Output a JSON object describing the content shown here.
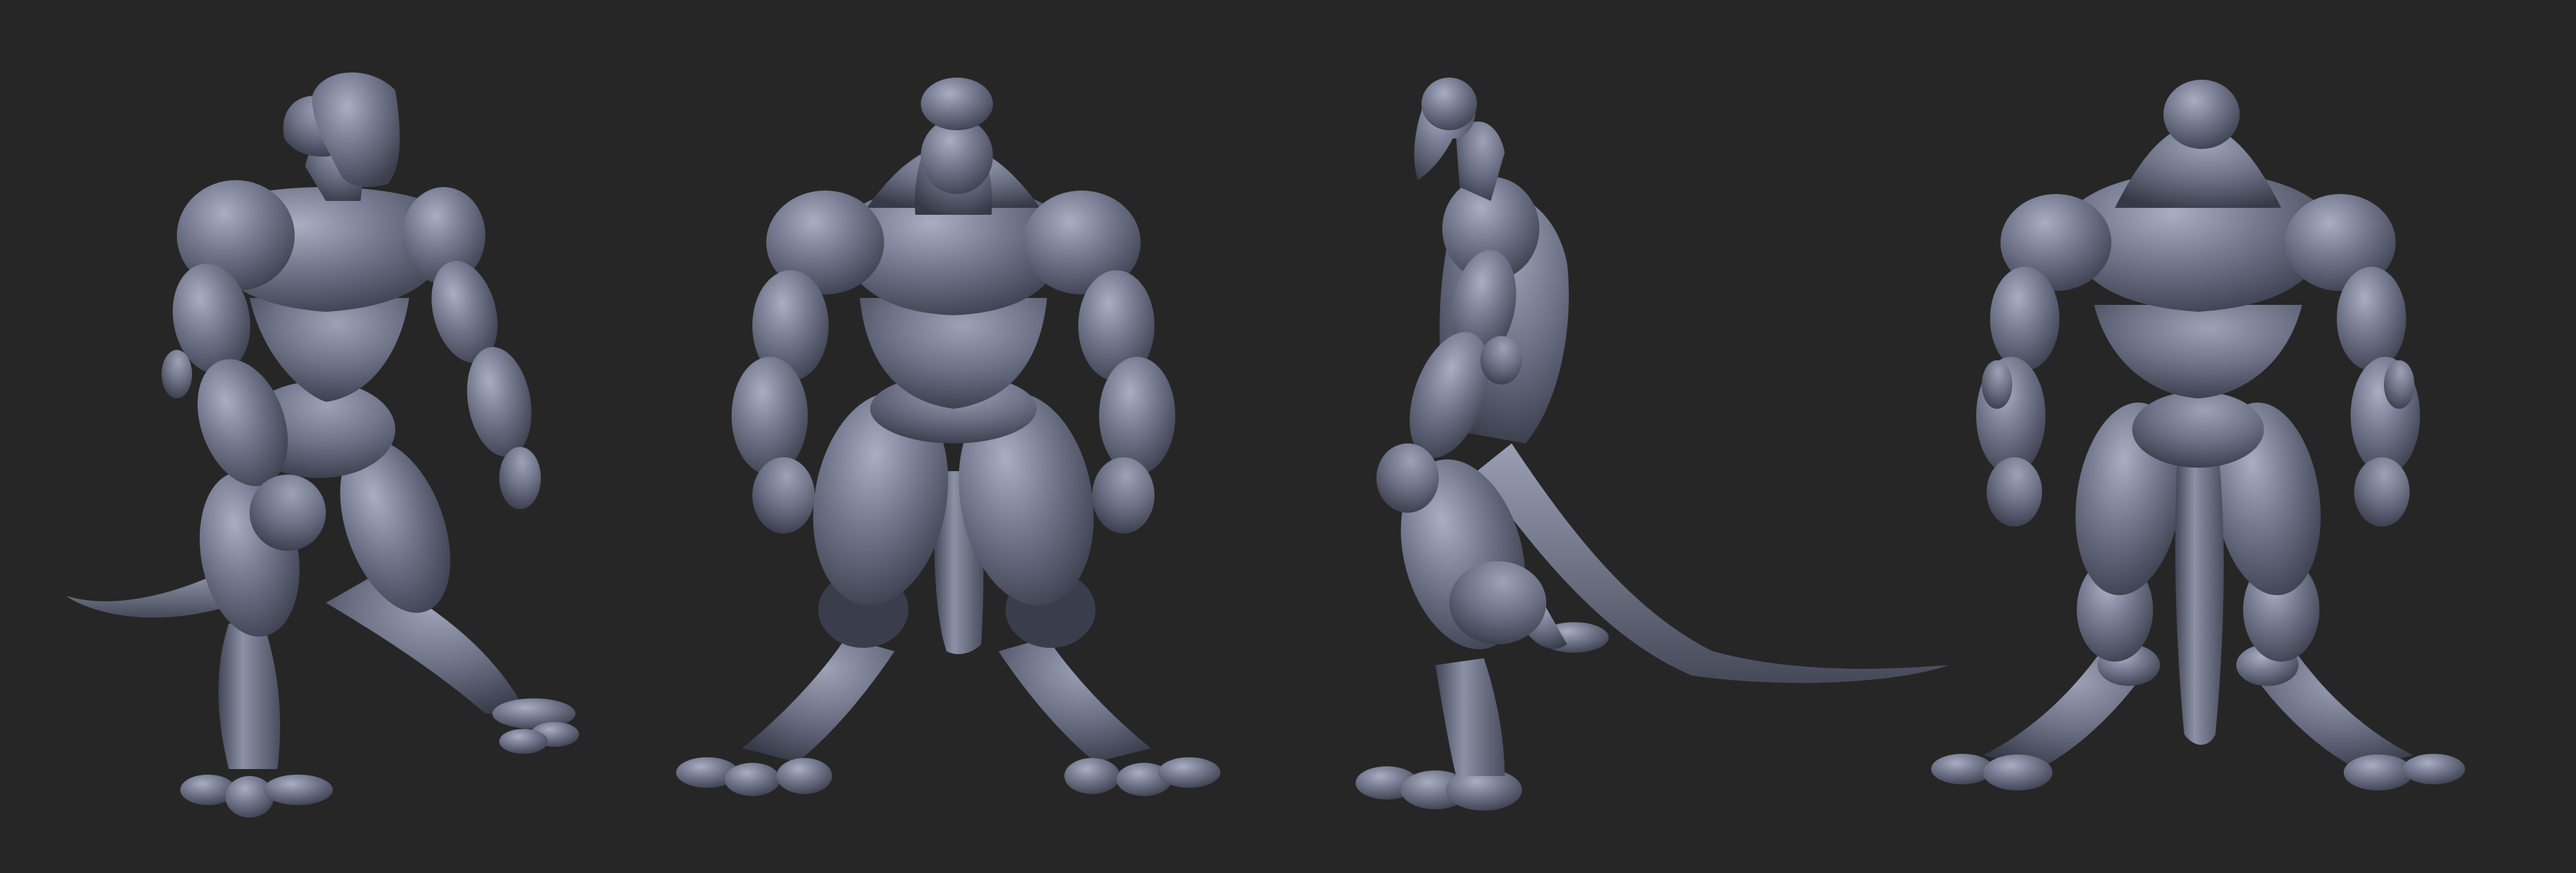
{
  "scene": {
    "background_color": "#262626",
    "clay_color": "#6f7388",
    "clay_light": "#9ea3b8",
    "clay_dark": "#3d4050",
    "views": [
      {
        "name": "three-quarter",
        "label": ""
      },
      {
        "name": "front",
        "label": ""
      },
      {
        "name": "side",
        "label": ""
      },
      {
        "name": "back",
        "label": ""
      }
    ]
  }
}
